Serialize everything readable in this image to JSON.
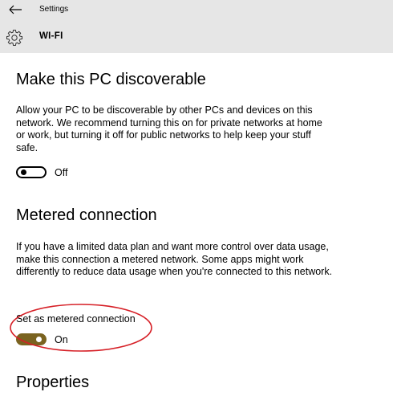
{
  "header": {
    "app_title": "Settings",
    "page_title": "WI-FI",
    "back_icon": "arrow-left-icon",
    "page_icon": "gear-icon",
    "background": "#e6e6e6"
  },
  "discoverable": {
    "title": "Make this PC discoverable",
    "description": "Allow your PC to be discoverable by other PCs and devices on this network. We recommend turning this on for private networks at home or work, but turning it off for public networks to help keep your stuff safe.",
    "toggle_state": "Off"
  },
  "metered": {
    "title": "Metered connection",
    "description": "If you have a limited data plan and want more control over data usage, make this connection a metered network. Some apps might work differently to reduce data usage when you're connected to this network.",
    "toggle_caption": "Set as metered connection",
    "toggle_state": "On",
    "toggle_on_color": "#7a6320",
    "highlight_color": "#d61f26"
  },
  "properties": {
    "title": "Properties"
  }
}
